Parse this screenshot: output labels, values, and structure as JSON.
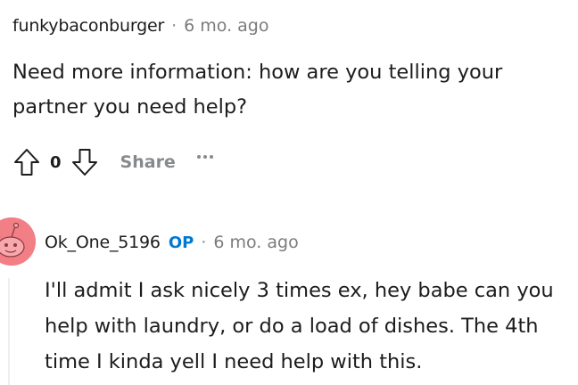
{
  "comment": {
    "author": "funkybaconburger",
    "separator": "·",
    "time": "6 mo. ago",
    "body": "Need more information: how are you telling your partner you need help?",
    "score": "0",
    "share_label": "Share",
    "upvote_icon": "arrow-up-icon",
    "downvote_icon": "arrow-down-icon",
    "more_icon": "ellipsis-icon"
  },
  "reply": {
    "author": "Ok_One_5196",
    "op_label": "OP",
    "separator": "·",
    "time": "6 mo. ago",
    "body": "I'll admit I ask nicely 3 times ex, hey babe can you help with laundry, or do a load of dishes. The 4th time I kinda yell I need help with this.",
    "avatar_color": "#f27e86"
  },
  "colors": {
    "text": "#1c1c1c",
    "muted": "#878a8c",
    "op": "#0079d3"
  }
}
